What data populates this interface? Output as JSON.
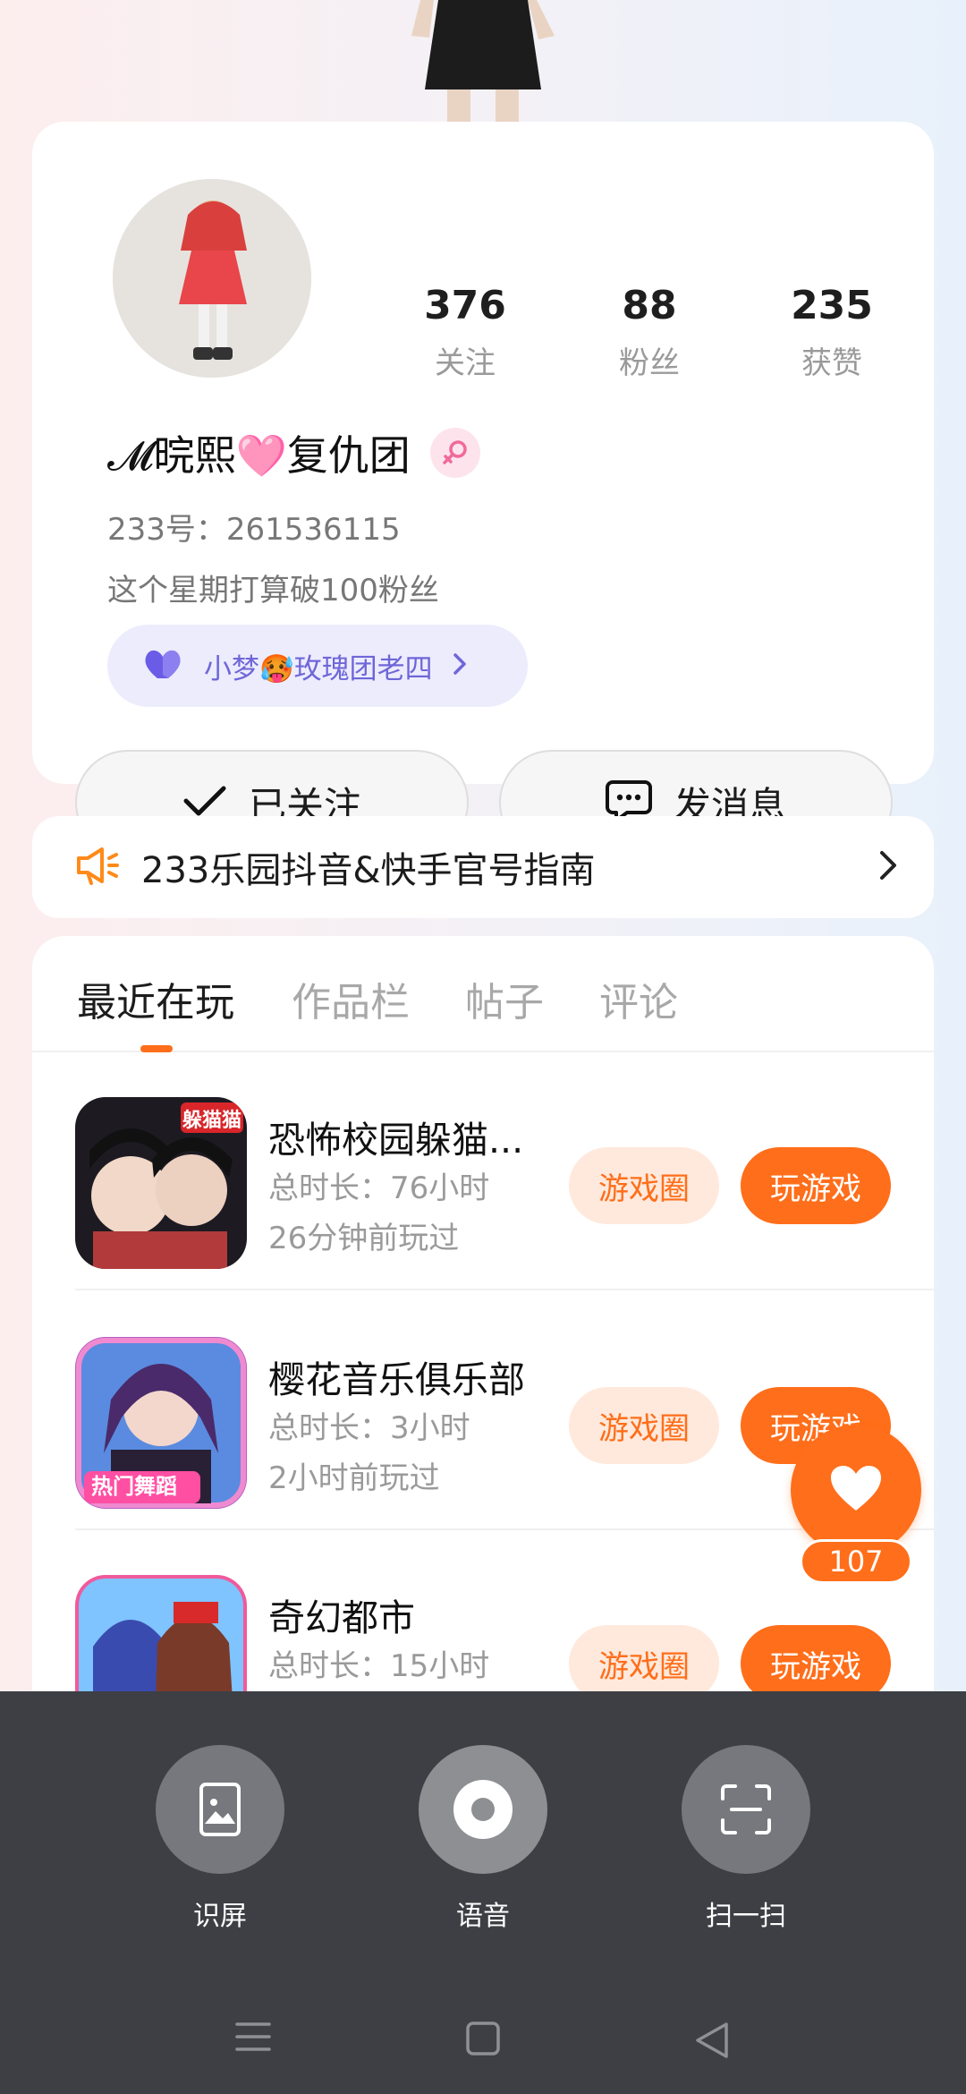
{
  "profile": {
    "stats": [
      {
        "value": "376",
        "label": "关注"
      },
      {
        "value": "88",
        "label": "粉丝"
      },
      {
        "value": "235",
        "label": "获赞"
      }
    ],
    "name": "𝓜晥熙🩷复仇团",
    "gender_icon": "female-icon",
    "uid": "233号：261536115",
    "bio": "这个星期打算破100粉丝",
    "club": "小梦🥵玫瑰团老四",
    "follow_button": "已关注",
    "message_button": "发消息"
  },
  "notice": {
    "text": "233乐园抖音&快手官号指南"
  },
  "tabs": [
    {
      "label": "最近在玩",
      "active": true
    },
    {
      "label": "作品栏",
      "active": false
    },
    {
      "label": "帖子",
      "active": false
    },
    {
      "label": "评论",
      "active": false
    }
  ],
  "games": [
    {
      "title": "恐怖校园躲猫...",
      "duration": "总时长：76小时",
      "last_played": "26分钟前玩过",
      "icon_badge": "躲猫猫",
      "circle_label": "游戏圈",
      "play_label": "玩游戏"
    },
    {
      "title": "樱花音乐俱乐部",
      "duration": "总时长：3小时",
      "last_played": "2小时前玩过",
      "icon_badge": "热门舞蹈",
      "circle_label": "游戏圈",
      "play_label": "玩游戏"
    },
    {
      "title": "奇幻都市",
      "duration": "总时长：15小时",
      "last_played": "",
      "icon_badge": "",
      "circle_label": "游戏圈",
      "play_label": "玩游戏"
    }
  ],
  "like": {
    "count": "107"
  },
  "tools": [
    {
      "label": "识屏",
      "icon": "screen-recognize-icon"
    },
    {
      "label": "语音",
      "icon": "voice-icon"
    },
    {
      "label": "扫一扫",
      "icon": "scan-icon"
    }
  ],
  "colors": {
    "accent": "#ff6e1a",
    "club_text": "#6f66d8",
    "overlay": "#3d3f45"
  }
}
